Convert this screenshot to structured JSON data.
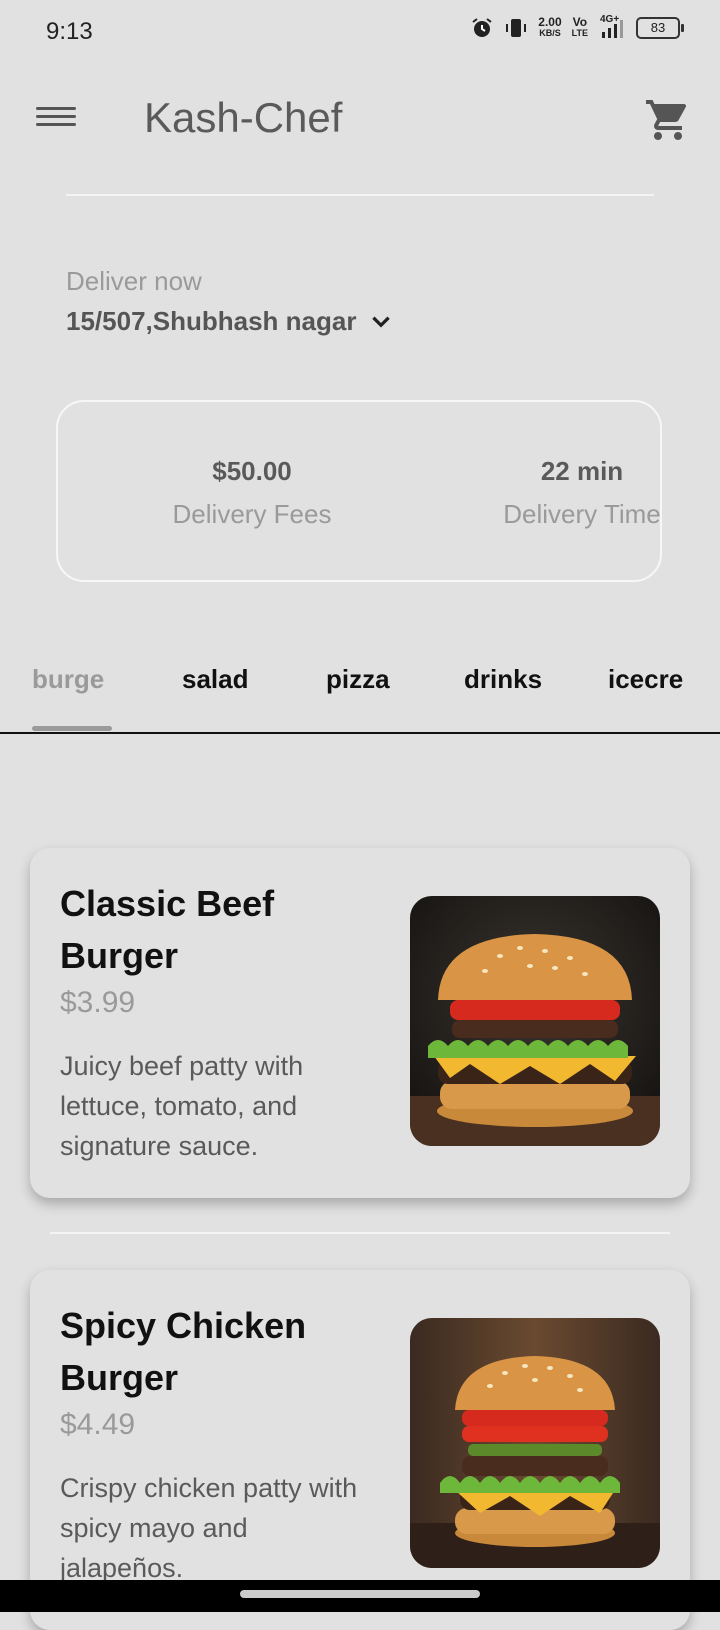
{
  "status": {
    "time": "9:13",
    "speed_top": "2.00",
    "speed_bottom": "KB/S",
    "volte_top": "Vo",
    "volte_bottom": "LTE",
    "network": "4G+",
    "battery": "83"
  },
  "app": {
    "title": "Kash-Chef",
    "menu_icon": "menu-icon",
    "cart_icon": "cart-icon"
  },
  "delivery": {
    "label": "Deliver now",
    "address": "15/507,Shubhash nagar",
    "fees_value": "$50.00",
    "fees_label": "Delivery Fees",
    "time_value": "22 min",
    "time_label": "Delivery Time"
  },
  "tabs": [
    {
      "label": "burger",
      "visible": "burge",
      "active": true
    },
    {
      "label": "salad",
      "visible": "salad",
      "active": false
    },
    {
      "label": "pizza",
      "visible": "pizza",
      "active": false
    },
    {
      "label": "drinks",
      "visible": "drinks",
      "active": false
    },
    {
      "label": "icecream",
      "visible": "icecre",
      "active": false
    }
  ],
  "items": [
    {
      "name": "Classic Beef Burger",
      "price": "$3.99",
      "description": "Juicy beef patty with lettuce, tomato, and signature sauce.",
      "image": "burger-photo"
    },
    {
      "name": "Spicy Chicken Burger",
      "price": "$4.49",
      "description": "Crispy chicken patty with spicy mayo and jalapeños.",
      "image": "burger-photo"
    }
  ],
  "colors": {
    "background": "#e1e1e1",
    "muted": "#9a9a9a",
    "dark": "#111111"
  }
}
